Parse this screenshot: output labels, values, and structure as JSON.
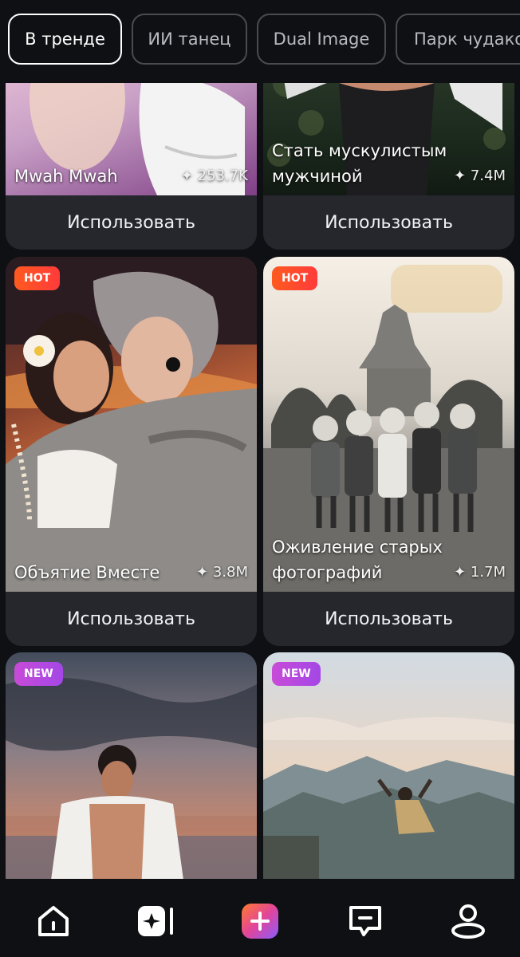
{
  "tabs": [
    {
      "label": "В тренде",
      "active": true
    },
    {
      "label": "ИИ танец",
      "active": false
    },
    {
      "label": "Dual Image",
      "active": false
    },
    {
      "label": "Парк чудаков",
      "active": false
    }
  ],
  "cards": [
    {
      "title": "Mwah Mwah",
      "count": "253.7K",
      "button": "Использовать"
    },
    {
      "title": "Стать мускулистым мужчиной",
      "count": "7.4M",
      "button": "Использовать"
    },
    {
      "badge": "HOT",
      "title": "Объятие Вместе",
      "count": "3.8M",
      "button": "Использовать"
    },
    {
      "badge": "HOT",
      "title": "Оживление старых фотографий",
      "count": "1.7M",
      "button": "Использовать"
    },
    {
      "badge": "NEW"
    },
    {
      "badge": "NEW"
    }
  ],
  "nav": {
    "items": [
      {
        "icon": "home-icon"
      },
      {
        "icon": "sparkle-card-icon"
      },
      {
        "icon": "plus-icon",
        "accent": "#e2459a"
      },
      {
        "icon": "chat-minus-icon"
      },
      {
        "icon": "profile-icon"
      }
    ]
  },
  "colors": {
    "background": "#0f1013",
    "card": "#25272d",
    "hot": "#ff4a2a",
    "new": "#b84ade"
  }
}
